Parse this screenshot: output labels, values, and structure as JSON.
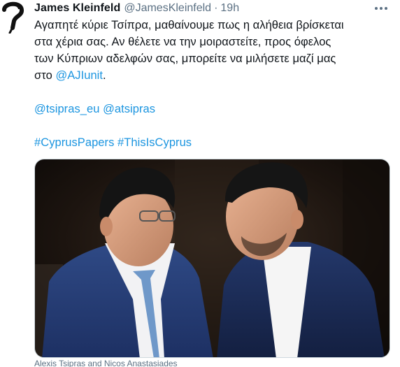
{
  "author": {
    "display_name": "James Kleinfeld",
    "handle": "@JamesKleinfeld",
    "separator": "·",
    "time": "19h",
    "avatar_icon": "question-mark-avatar-icon"
  },
  "more_icon": "ellipsis-icon",
  "tweet": {
    "line1": "Αγαπητέ κύριε Τσίπρα, μαθαίνουμε πως η αλήθεια βρίσκεται",
    "line2": "στα χέρια σας. Αν θέλετε να την μοιραστείτε, προς όφελος",
    "line3": "των Κύπριων αδελφών σας, μπορείτε να μιλήσετε μαζί μας",
    "line4_prefix": "στο ",
    "line4_mention": "@AJIunit",
    "line4_suffix": ".",
    "mention1": "@tsipras_eu",
    "mention2": "@atsipras",
    "hashtag1": "#CyprusPapers",
    "hashtag2": "#ThisIsCyprus"
  },
  "media": {
    "caption": "Alexis Tsipras and Nicos Anastasiades"
  },
  "colors": {
    "link": "#1b95e0",
    "secondary_text": "#5b7083",
    "text": "#0f1419"
  }
}
